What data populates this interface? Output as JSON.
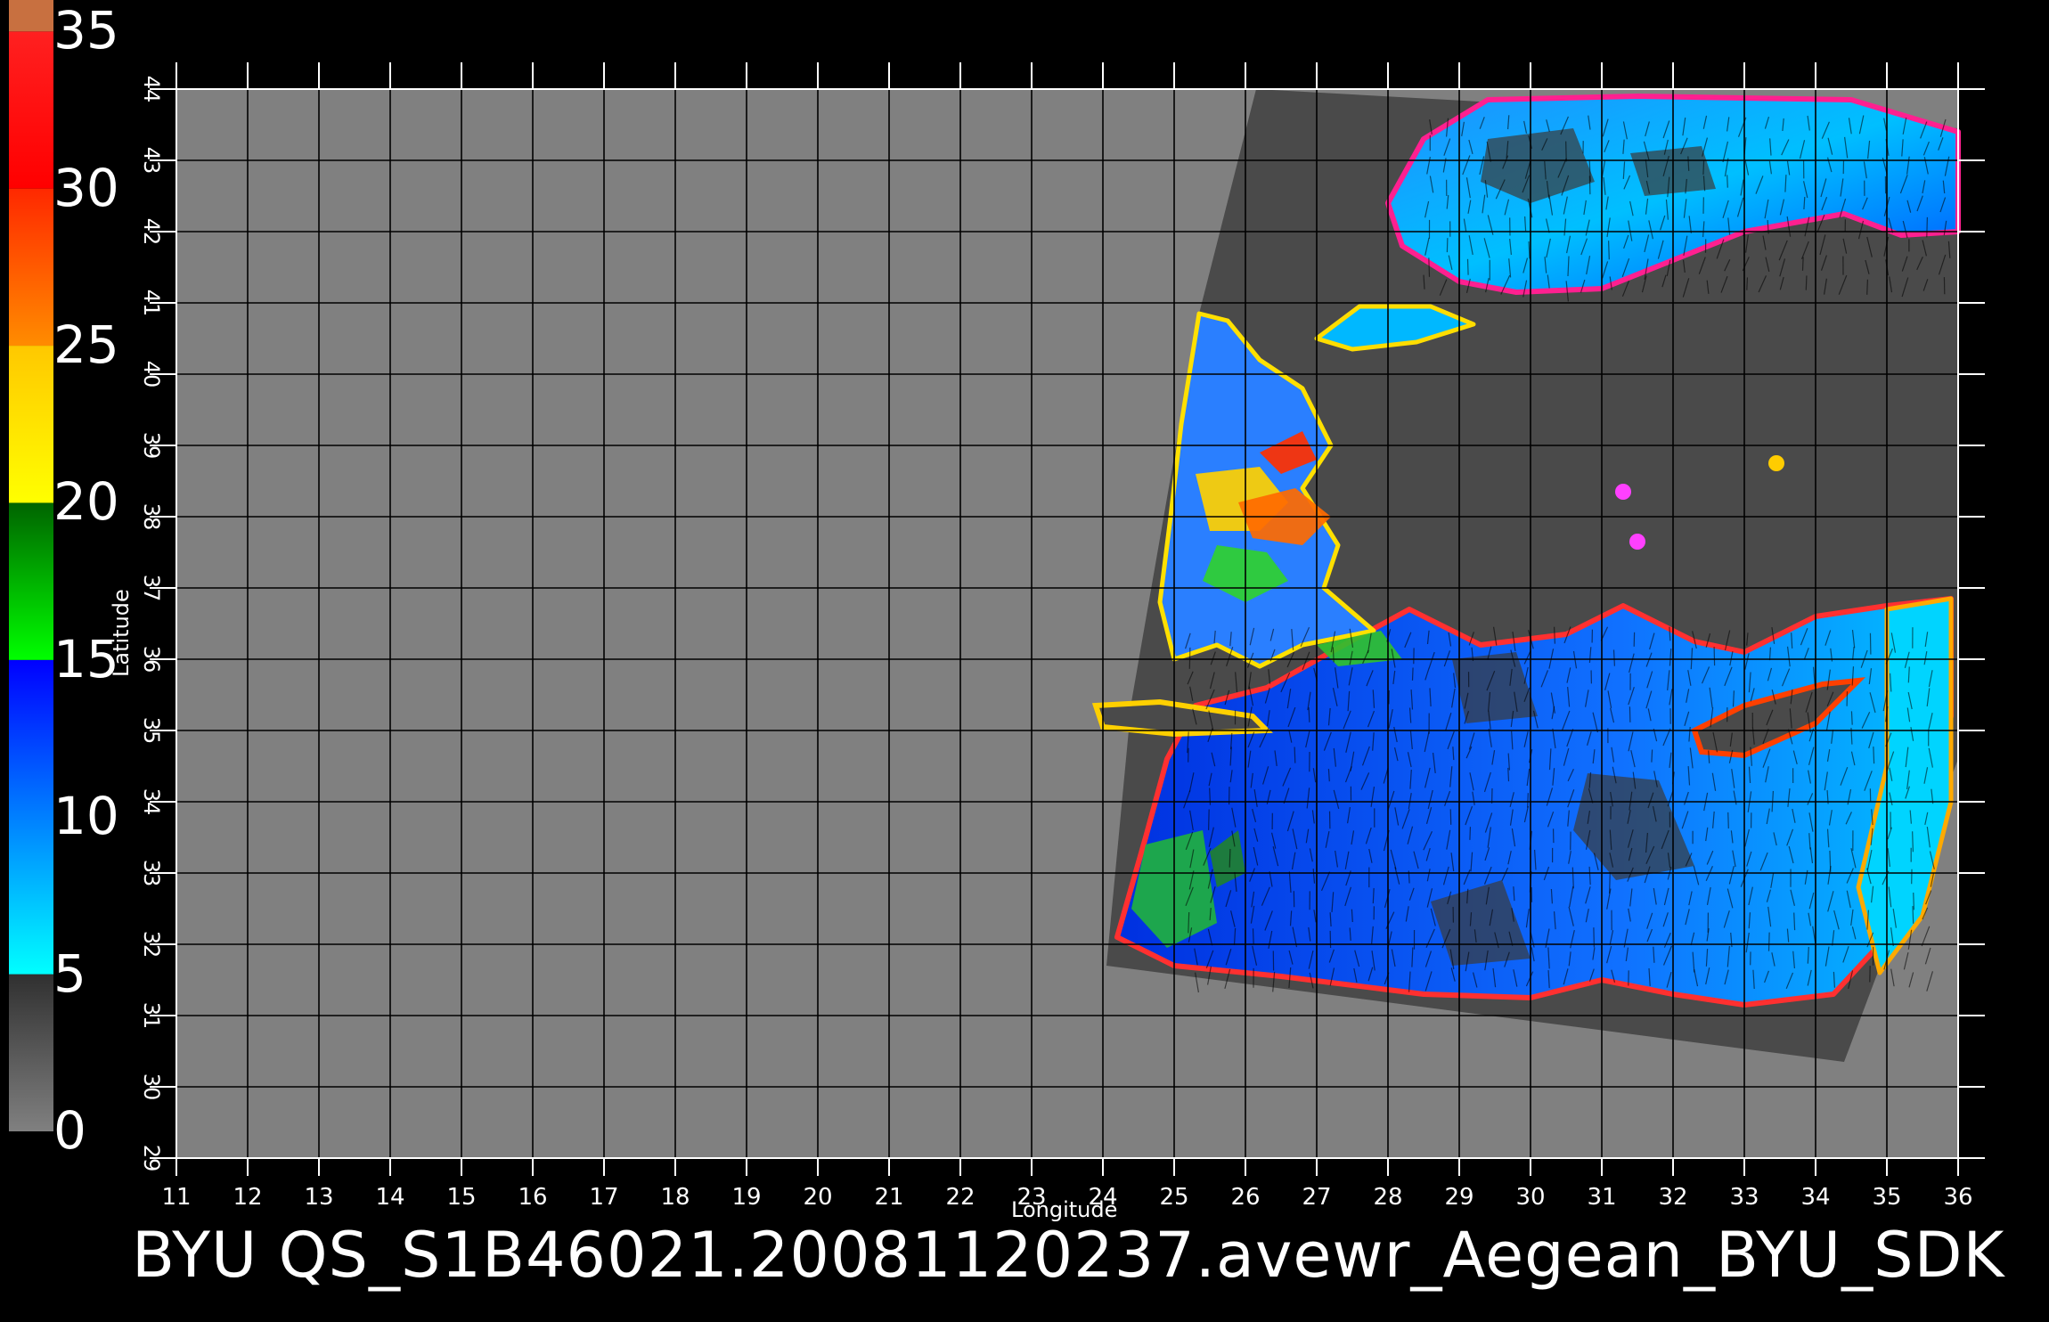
{
  "colorbar": {
    "ticks": [
      "35",
      "30",
      "25",
      "20",
      "15",
      "10",
      "5",
      "0"
    ],
    "range": [
      0,
      35
    ],
    "segments": [
      {
        "from": 0,
        "to": 5,
        "colors": [
          "#808080",
          "#303030"
        ]
      },
      {
        "from": 5,
        "to": 15,
        "colors": [
          "#00ffff",
          "#0000ff"
        ]
      },
      {
        "from": 15,
        "to": 20,
        "colors": [
          "#00ff00",
          "#006400"
        ]
      },
      {
        "from": 20,
        "to": 25,
        "colors": [
          "#ffff00",
          "#ffc800"
        ]
      },
      {
        "from": 25,
        "to": 30,
        "colors": [
          "#ff8c00",
          "#ff2800"
        ]
      },
      {
        "from": 30,
        "to": 35,
        "colors": [
          "#ff0000",
          "#ff2020"
        ]
      },
      {
        "from": 35,
        "to": 36,
        "colors": [
          "#c87040",
          "#c87040"
        ]
      }
    ]
  },
  "map": {
    "lon_range": [
      11,
      36
    ],
    "lat_range": [
      29,
      44
    ],
    "lon_ticks": [
      "11",
      "12",
      "13",
      "14",
      "15",
      "16",
      "17",
      "18",
      "19",
      "20",
      "21",
      "22",
      "23",
      "24",
      "25",
      "26",
      "27",
      "28",
      "29",
      "30",
      "31",
      "32",
      "33",
      "34",
      "35",
      "36"
    ],
    "lat_ticks": [
      "29",
      "30",
      "31",
      "32",
      "33",
      "34",
      "35",
      "36",
      "37",
      "38",
      "39",
      "40",
      "41",
      "42",
      "43",
      "44"
    ],
    "xlabel": "Longitude",
    "ylabel": "Latitude",
    "background_color": "#808080",
    "swath_color": "#4a4a4a",
    "grid_color": "#000000"
  },
  "footer": {
    "title": "BYU  QS_S1B46021.20081120237.avewr_Aegean_BYU_SDK"
  }
}
